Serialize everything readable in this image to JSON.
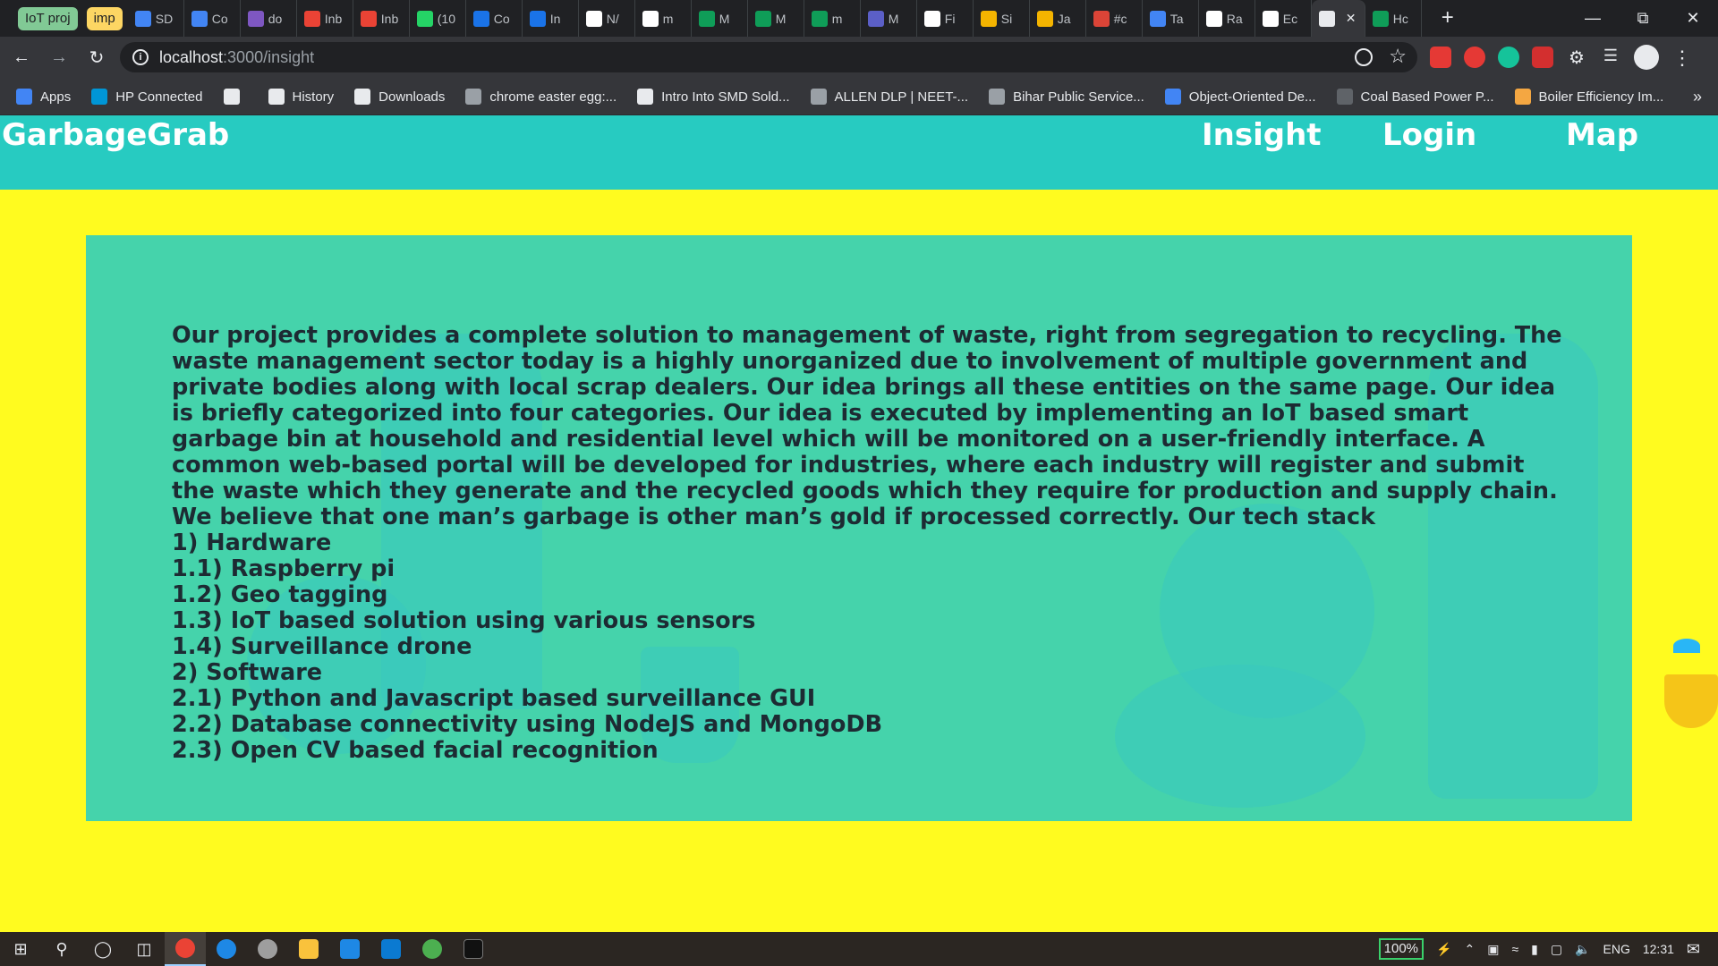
{
  "browser": {
    "tab_groups": [
      "IoT proj",
      "imp"
    ],
    "tabs": [
      {
        "label": "SD",
        "color": "#4285f4"
      },
      {
        "label": "Co",
        "color": "#4285f4"
      },
      {
        "label": "do",
        "color": "#7e57c2"
      },
      {
        "label": "Inb",
        "color": "#ea4335"
      },
      {
        "label": "Inb",
        "color": "#ea4335"
      },
      {
        "label": "(10",
        "color": "#25d366"
      },
      {
        "label": "Co",
        "color": "#1a73e8"
      },
      {
        "label": "In",
        "color": "#1a73e8"
      },
      {
        "label": "N/",
        "color": "#ffffff"
      },
      {
        "label": "m",
        "color": "#ffffff"
      },
      {
        "label": "M",
        "color": "#0f9d58"
      },
      {
        "label": "M",
        "color": "#0f9d58"
      },
      {
        "label": "m",
        "color": "#0f9d58"
      },
      {
        "label": "M",
        "color": "#5b5fc7"
      },
      {
        "label": "Fi",
        "color": "#ffffff"
      },
      {
        "label": "Si",
        "color": "#f4b400"
      },
      {
        "label": "Ja",
        "color": "#f4b400"
      },
      {
        "label": "#c",
        "color": "#db4437"
      },
      {
        "label": "Ta",
        "color": "#4285f4"
      },
      {
        "label": "Ra",
        "color": "#ffffff"
      },
      {
        "label": "Ec",
        "color": "#ffffff"
      },
      {
        "label": "",
        "color": "#e8eaed",
        "active": true
      },
      {
        "label": "Hc",
        "color": "#0f9d58"
      }
    ],
    "new_tab_label": "+",
    "url_host": "localhost",
    "url_path": ":3000/insight",
    "bookmarks": [
      {
        "label": "Apps",
        "color": "#4285f4"
      },
      {
        "label": "HP Connected",
        "color": "#0096d6"
      },
      {
        "label": "",
        "color": "#e8eaed"
      },
      {
        "label": "History",
        "color": "#e8eaed"
      },
      {
        "label": "Downloads",
        "color": "#e8eaed"
      },
      {
        "label": "chrome easter egg:...",
        "color": "#9aa0a6"
      },
      {
        "label": "Intro Into SMD Sold...",
        "color": "#e8eaed"
      },
      {
        "label": "ALLEN DLP | NEET-...",
        "color": "#9aa0a6"
      },
      {
        "label": "Bihar Public Service...",
        "color": "#9aa0a6"
      },
      {
        "label": "Object-Oriented De...",
        "color": "#4285f4"
      },
      {
        "label": "Coal Based Power P...",
        "color": "#5f6368"
      },
      {
        "label": "Boiler Efficiency Im...",
        "color": "#f4a742"
      }
    ],
    "bookmarks_more": "»"
  },
  "site": {
    "brand": "GarbageGrab",
    "nav": {
      "insight": "Insight",
      "login": "Login",
      "map": "Map"
    },
    "colors": {
      "navbar": "#27cbc1",
      "page_bg": "#fffb1f",
      "card_bg": "#45d3ab"
    }
  },
  "insight": {
    "paragraph": "Our project provides a complete solution to management of waste, right from segregation to recycling. The waste management sector today is a highly unorganized due to involvement of multiple government and private bodies along with local scrap dealers. Our idea brings all these entities on the same page. Our idea is briefly categorized into four categories. Our idea is executed by implementing an IoT based smart garbage bin at household and residential level which will be monitored on a user-friendly interface. A common web-based portal will be developed for industries, where each industry will register and submit the waste which they generate and the recycled goods which they require for production and supply chain. We believe that one man’s garbage is other man’s gold if processed correctly. Our tech stack",
    "stack": [
      "1) Hardware",
      "1.1) Raspberry pi",
      "1.2) Geo tagging",
      "1.3) IoT based solution using various sensors",
      "1.4) Surveillance drone",
      "2) Software",
      "2.1) Python and Javascript based surveillance GUI",
      "2.2) Database connectivity using NodeJS and MongoDB",
      "2.3) Open CV based facial recognition"
    ]
  },
  "taskbar": {
    "battery": "100%",
    "language": "ENG",
    "time": "12:31"
  }
}
